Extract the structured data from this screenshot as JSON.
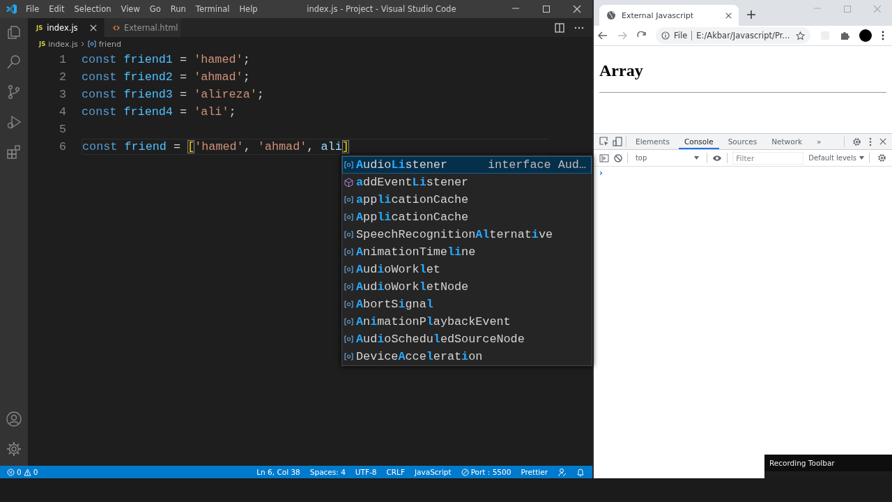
{
  "vscode": {
    "title": "index.js - Project - Visual Studio Code",
    "menu": [
      "File",
      "Edit",
      "Selection",
      "View",
      "Go",
      "Run",
      "Terminal",
      "Help"
    ],
    "tabs": [
      {
        "label": "index.js",
        "kind": "js",
        "badge": "JS",
        "selected": true
      },
      {
        "label": "External.html",
        "kind": "html",
        "selected": false
      }
    ],
    "breadcrumb": [
      {
        "label": "index.js",
        "kind": "file",
        "badge": "JS"
      },
      {
        "label": "friend",
        "kind": "symbol"
      }
    ],
    "lines": [
      {
        "number": "1",
        "current": false,
        "tokens": [
          {
            "text": "const ",
            "kind": "keyword"
          },
          {
            "text": "friend1",
            "kind": "variable"
          },
          {
            "text": " = ",
            "kind": "operator"
          },
          {
            "text": "'hamed'",
            "kind": "string"
          },
          {
            "text": ";",
            "kind": "punct"
          }
        ]
      },
      {
        "number": "2",
        "current": false,
        "tokens": [
          {
            "text": "const ",
            "kind": "keyword"
          },
          {
            "text": "friend2",
            "kind": "variable"
          },
          {
            "text": " = ",
            "kind": "operator"
          },
          {
            "text": "'ahmad'",
            "kind": "string"
          },
          {
            "text": ";",
            "kind": "punct"
          }
        ]
      },
      {
        "number": "3",
        "current": false,
        "tokens": [
          {
            "text": "const ",
            "kind": "keyword"
          },
          {
            "text": "friend3",
            "kind": "variable"
          },
          {
            "text": " = ",
            "kind": "operator"
          },
          {
            "text": "'alireza'",
            "kind": "string"
          },
          {
            "text": ";",
            "kind": "punct"
          }
        ]
      },
      {
        "number": "4",
        "current": false,
        "tokens": [
          {
            "text": "const ",
            "kind": "keyword"
          },
          {
            "text": "friend4",
            "kind": "variable"
          },
          {
            "text": " = ",
            "kind": "operator"
          },
          {
            "text": "'ali'",
            "kind": "string"
          },
          {
            "text": ";",
            "kind": "punct"
          }
        ]
      },
      {
        "number": "5",
        "current": false
      },
      {
        "number": "6",
        "current": true,
        "tokens": [
          {
            "text": "const ",
            "kind": "keyword"
          },
          {
            "text": "friend",
            "kind": "variable"
          },
          {
            "text": " = ",
            "kind": "operator"
          },
          {
            "text": "[",
            "kind": "bracket"
          },
          {
            "text": "'hamed'",
            "kind": "string"
          },
          {
            "text": ", ",
            "kind": "punct"
          },
          {
            "text": "'ahmad'",
            "kind": "string"
          },
          {
            "text": ", ",
            "kind": "punct"
          },
          {
            "text": "ali",
            "kind": "typed"
          },
          {
            "text": "]",
            "kind": "bracket"
          }
        ]
      }
    ],
    "suggestions": [
      {
        "kind": "variable",
        "selected": true,
        "detail": "interface Aud…",
        "parts": [
          {
            "text": "A",
            "match": true
          },
          {
            "text": "udio",
            "match": false
          },
          {
            "text": "Li",
            "match": true
          },
          {
            "text": "stener",
            "match": false
          }
        ]
      },
      {
        "kind": "method",
        "selected": false,
        "parts": [
          {
            "text": "a",
            "match": true
          },
          {
            "text": "ddEvent",
            "match": false
          },
          {
            "text": "Li",
            "match": true
          },
          {
            "text": "stener",
            "match": false
          }
        ]
      },
      {
        "kind": "variable",
        "selected": false,
        "parts": [
          {
            "text": "a",
            "match": true
          },
          {
            "text": "pp",
            "match": false
          },
          {
            "text": "li",
            "match": true
          },
          {
            "text": "cationCache",
            "match": false
          }
        ]
      },
      {
        "kind": "variable",
        "selected": false,
        "parts": [
          {
            "text": "A",
            "match": true
          },
          {
            "text": "pp",
            "match": false
          },
          {
            "text": "li",
            "match": true
          },
          {
            "text": "cationCache",
            "match": false
          }
        ]
      },
      {
        "kind": "variable",
        "selected": false,
        "parts": [
          {
            "text": "SpeechRecognition",
            "match": false
          },
          {
            "text": "Al",
            "match": true
          },
          {
            "text": "ternat",
            "match": false
          },
          {
            "text": "i",
            "match": true
          },
          {
            "text": "ve",
            "match": false
          }
        ]
      },
      {
        "kind": "variable",
        "selected": false,
        "parts": [
          {
            "text": "A",
            "match": true
          },
          {
            "text": "nimationTime",
            "match": false
          },
          {
            "text": "li",
            "match": true
          },
          {
            "text": "ne",
            "match": false
          }
        ]
      },
      {
        "kind": "variable",
        "selected": false,
        "parts": [
          {
            "text": "A",
            "match": true
          },
          {
            "text": "ud",
            "match": false
          },
          {
            "text": "i",
            "match": true
          },
          {
            "text": "oWork",
            "match": false
          },
          {
            "text": "l",
            "match": true
          },
          {
            "text": "et",
            "match": false
          }
        ]
      },
      {
        "kind": "variable",
        "selected": false,
        "parts": [
          {
            "text": "A",
            "match": true
          },
          {
            "text": "ud",
            "match": false
          },
          {
            "text": "i",
            "match": true
          },
          {
            "text": "oWork",
            "match": false
          },
          {
            "text": "l",
            "match": true
          },
          {
            "text": "etNode",
            "match": false
          }
        ]
      },
      {
        "kind": "variable",
        "selected": false,
        "parts": [
          {
            "text": "A",
            "match": true
          },
          {
            "text": "bortS",
            "match": false
          },
          {
            "text": "i",
            "match": true
          },
          {
            "text": "gna",
            "match": false
          },
          {
            "text": "l",
            "match": true
          }
        ]
      },
      {
        "kind": "variable",
        "selected": false,
        "parts": [
          {
            "text": "A",
            "match": true
          },
          {
            "text": "n",
            "match": false
          },
          {
            "text": "i",
            "match": true
          },
          {
            "text": "mationP",
            "match": false
          },
          {
            "text": "l",
            "match": true
          },
          {
            "text": "aybackEvent",
            "match": false
          }
        ]
      },
      {
        "kind": "variable",
        "selected": false,
        "parts": [
          {
            "text": "A",
            "match": true
          },
          {
            "text": "ud",
            "match": false
          },
          {
            "text": "i",
            "match": true
          },
          {
            "text": "oSchedu",
            "match": false
          },
          {
            "text": "l",
            "match": true
          },
          {
            "text": "edSourceNode",
            "match": false
          }
        ]
      },
      {
        "kind": "variable",
        "selected": false,
        "parts": [
          {
            "text": "Device",
            "match": false
          },
          {
            "text": "A",
            "match": true
          },
          {
            "text": "cce",
            "match": false
          },
          {
            "text": "l",
            "match": true
          },
          {
            "text": "erat",
            "match": false
          },
          {
            "text": "i",
            "match": true
          },
          {
            "text": "on",
            "match": false
          }
        ]
      }
    ],
    "status_bar": {
      "errors": "0",
      "warnings": "0",
      "items": [
        {
          "text": "Ln 6, Col 38",
          "kind": "text"
        },
        {
          "text": "Spaces: 4",
          "kind": "text"
        },
        {
          "text": "UTF-8",
          "kind": "text"
        },
        {
          "text": "CRLF",
          "kind": "text"
        },
        {
          "text": "JavaScript",
          "kind": "text"
        },
        {
          "text": "Port : 5500",
          "kind": "port"
        },
        {
          "text": "Prettier",
          "kind": "text"
        }
      ]
    }
  },
  "browser": {
    "tab": {
      "title": "External Javascript"
    },
    "address": {
      "scheme": "File",
      "url": "E:/Akbar/Javascript/Pr..."
    },
    "page": {
      "heading": "Array"
    },
    "devtools": {
      "tabs": [
        {
          "label": "Elements",
          "selected": false
        },
        {
          "label": "Console",
          "selected": true
        },
        {
          "label": "Sources",
          "selected": false
        },
        {
          "label": "Network",
          "selected": false
        }
      ],
      "more": "»",
      "context": "top",
      "filter": {
        "placeholder": "Filter"
      },
      "levels": "Default levels",
      "prompt": "›"
    }
  },
  "recording_toolbar": {
    "title": "Recording Toolbar"
  }
}
